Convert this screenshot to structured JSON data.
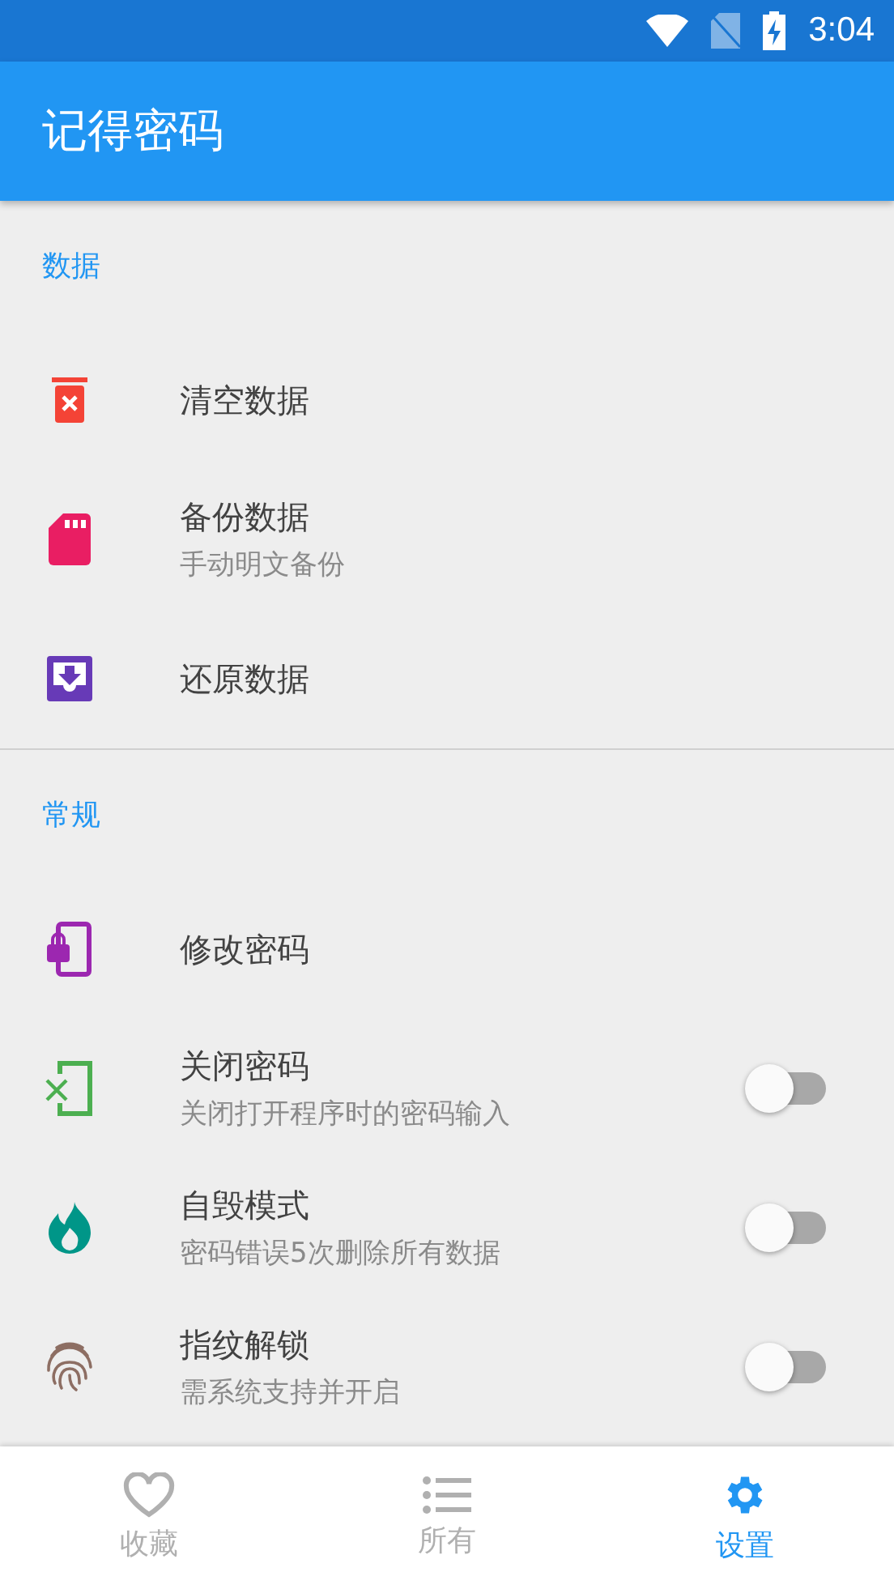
{
  "status_bar": {
    "time": "3:04"
  },
  "app_bar": {
    "title": "记得密码"
  },
  "sections": [
    {
      "header": "数据",
      "items": [
        {
          "kind": "action",
          "title": "清空数据"
        },
        {
          "kind": "action",
          "title": "备份数据",
          "subtitle": "手动明文备份"
        },
        {
          "kind": "action",
          "title": "还原数据"
        }
      ]
    },
    {
      "header": "常规",
      "items": [
        {
          "kind": "action",
          "title": "修改密码"
        },
        {
          "kind": "toggle",
          "title": "关闭密码",
          "subtitle": "关闭打开程序时的密码输入",
          "on": false
        },
        {
          "kind": "toggle",
          "title": "自毁模式",
          "subtitle": "密码错误5次删除所有数据",
          "on": false
        },
        {
          "kind": "toggle",
          "title": "指纹解锁",
          "subtitle": "需系统支持并开启",
          "on": false
        }
      ]
    }
  ],
  "bottom_nav": [
    {
      "label": "收藏",
      "selected": false
    },
    {
      "label": "所有",
      "selected": false
    },
    {
      "label": "设置",
      "selected": true
    }
  ]
}
